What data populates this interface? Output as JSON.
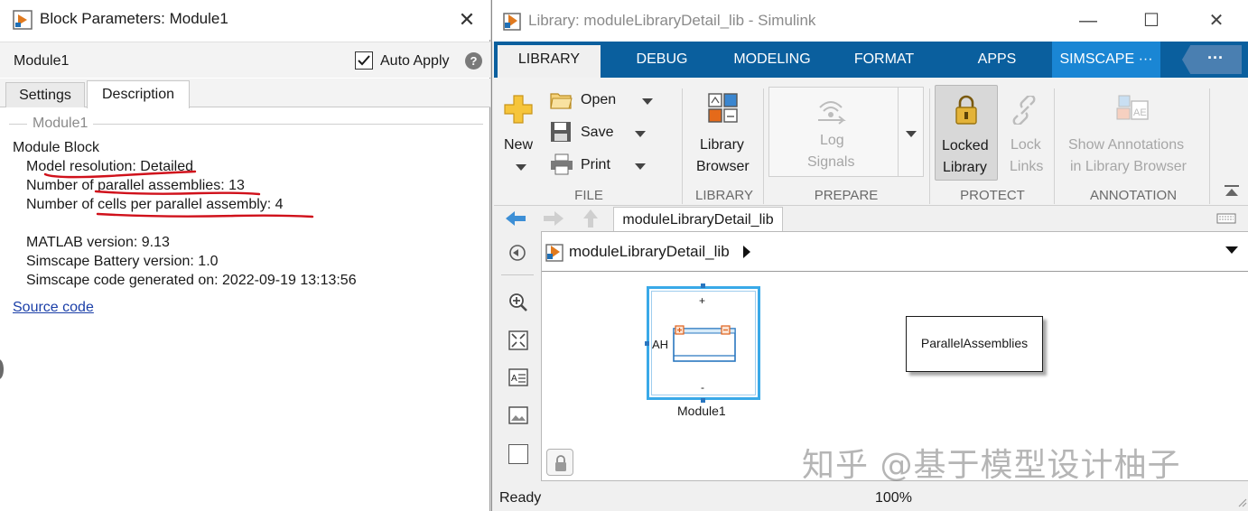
{
  "block_params": {
    "title": "Block Parameters: Module1",
    "close": "✕",
    "block_name": "Module1",
    "auto_apply_label": "Auto Apply",
    "auto_apply_checked": true,
    "help": "?",
    "tabs": [
      "Settings",
      "Description"
    ],
    "active_tab": "Description",
    "group_label": "Module1",
    "description": {
      "heading": "Module Block",
      "model_resolution": "Model resolution: Detailed",
      "parallel_assemblies": "Number of parallel assemblies: 13",
      "cells_per_assembly": "Number of cells per parallel assembly: 4",
      "matlab_version": "MATLAB version: 9.13",
      "battery_version": "Simscape Battery version: 1.0",
      "generated_on": "Simscape code generated on: 2022-09-19 13:13:56"
    },
    "source_link": "Source code"
  },
  "simulink": {
    "title": "Library: moduleLibraryDetail_lib - Simulink",
    "window_controls": [
      "—",
      "☐",
      "✕"
    ],
    "tabs": [
      "LIBRARY",
      "DEBUG",
      "MODELING",
      "FORMAT",
      "APPS",
      "SIMSCAPE ···"
    ],
    "active_tab": "LIBRARY",
    "more_label": "···",
    "ribbon": {
      "new_label": "New",
      "open_label": "Open",
      "save_label": "Save",
      "print_label": "Print",
      "file_section": "FILE",
      "library_browser": [
        "Library",
        "Browser"
      ],
      "library_section": "LIBRARY",
      "log_signals": [
        "Log",
        "Signals"
      ],
      "prepare_section": "PREPARE",
      "locked_library": [
        "Locked",
        "Library"
      ],
      "lock_links": [
        "Lock",
        "Links"
      ],
      "protect_section": "PROTECT",
      "show_annotations": [
        "Show Annotations",
        "in Library Browser"
      ],
      "annotation_section": "ANNOTATION"
    },
    "breadcrumb_tab": "moduleLibraryDetail_lib",
    "address": "moduleLibraryDetail_lib",
    "canvas": {
      "module_block_name": "Module1",
      "port_plus": "+",
      "port_minus": "-",
      "port_ah": "AH",
      "parallel_block_label": "ParallelAssemblies"
    },
    "status": "Ready",
    "zoom": "100%"
  },
  "watermark": "知乎 @基于模型设计柚子",
  "colors": {
    "tab_bar": "#0a5f9e",
    "simscape_tab": "#1a86d4",
    "link": "#1b3fa8",
    "annotation_red": "#d0111b",
    "module_highlight": "#39a9e8"
  }
}
